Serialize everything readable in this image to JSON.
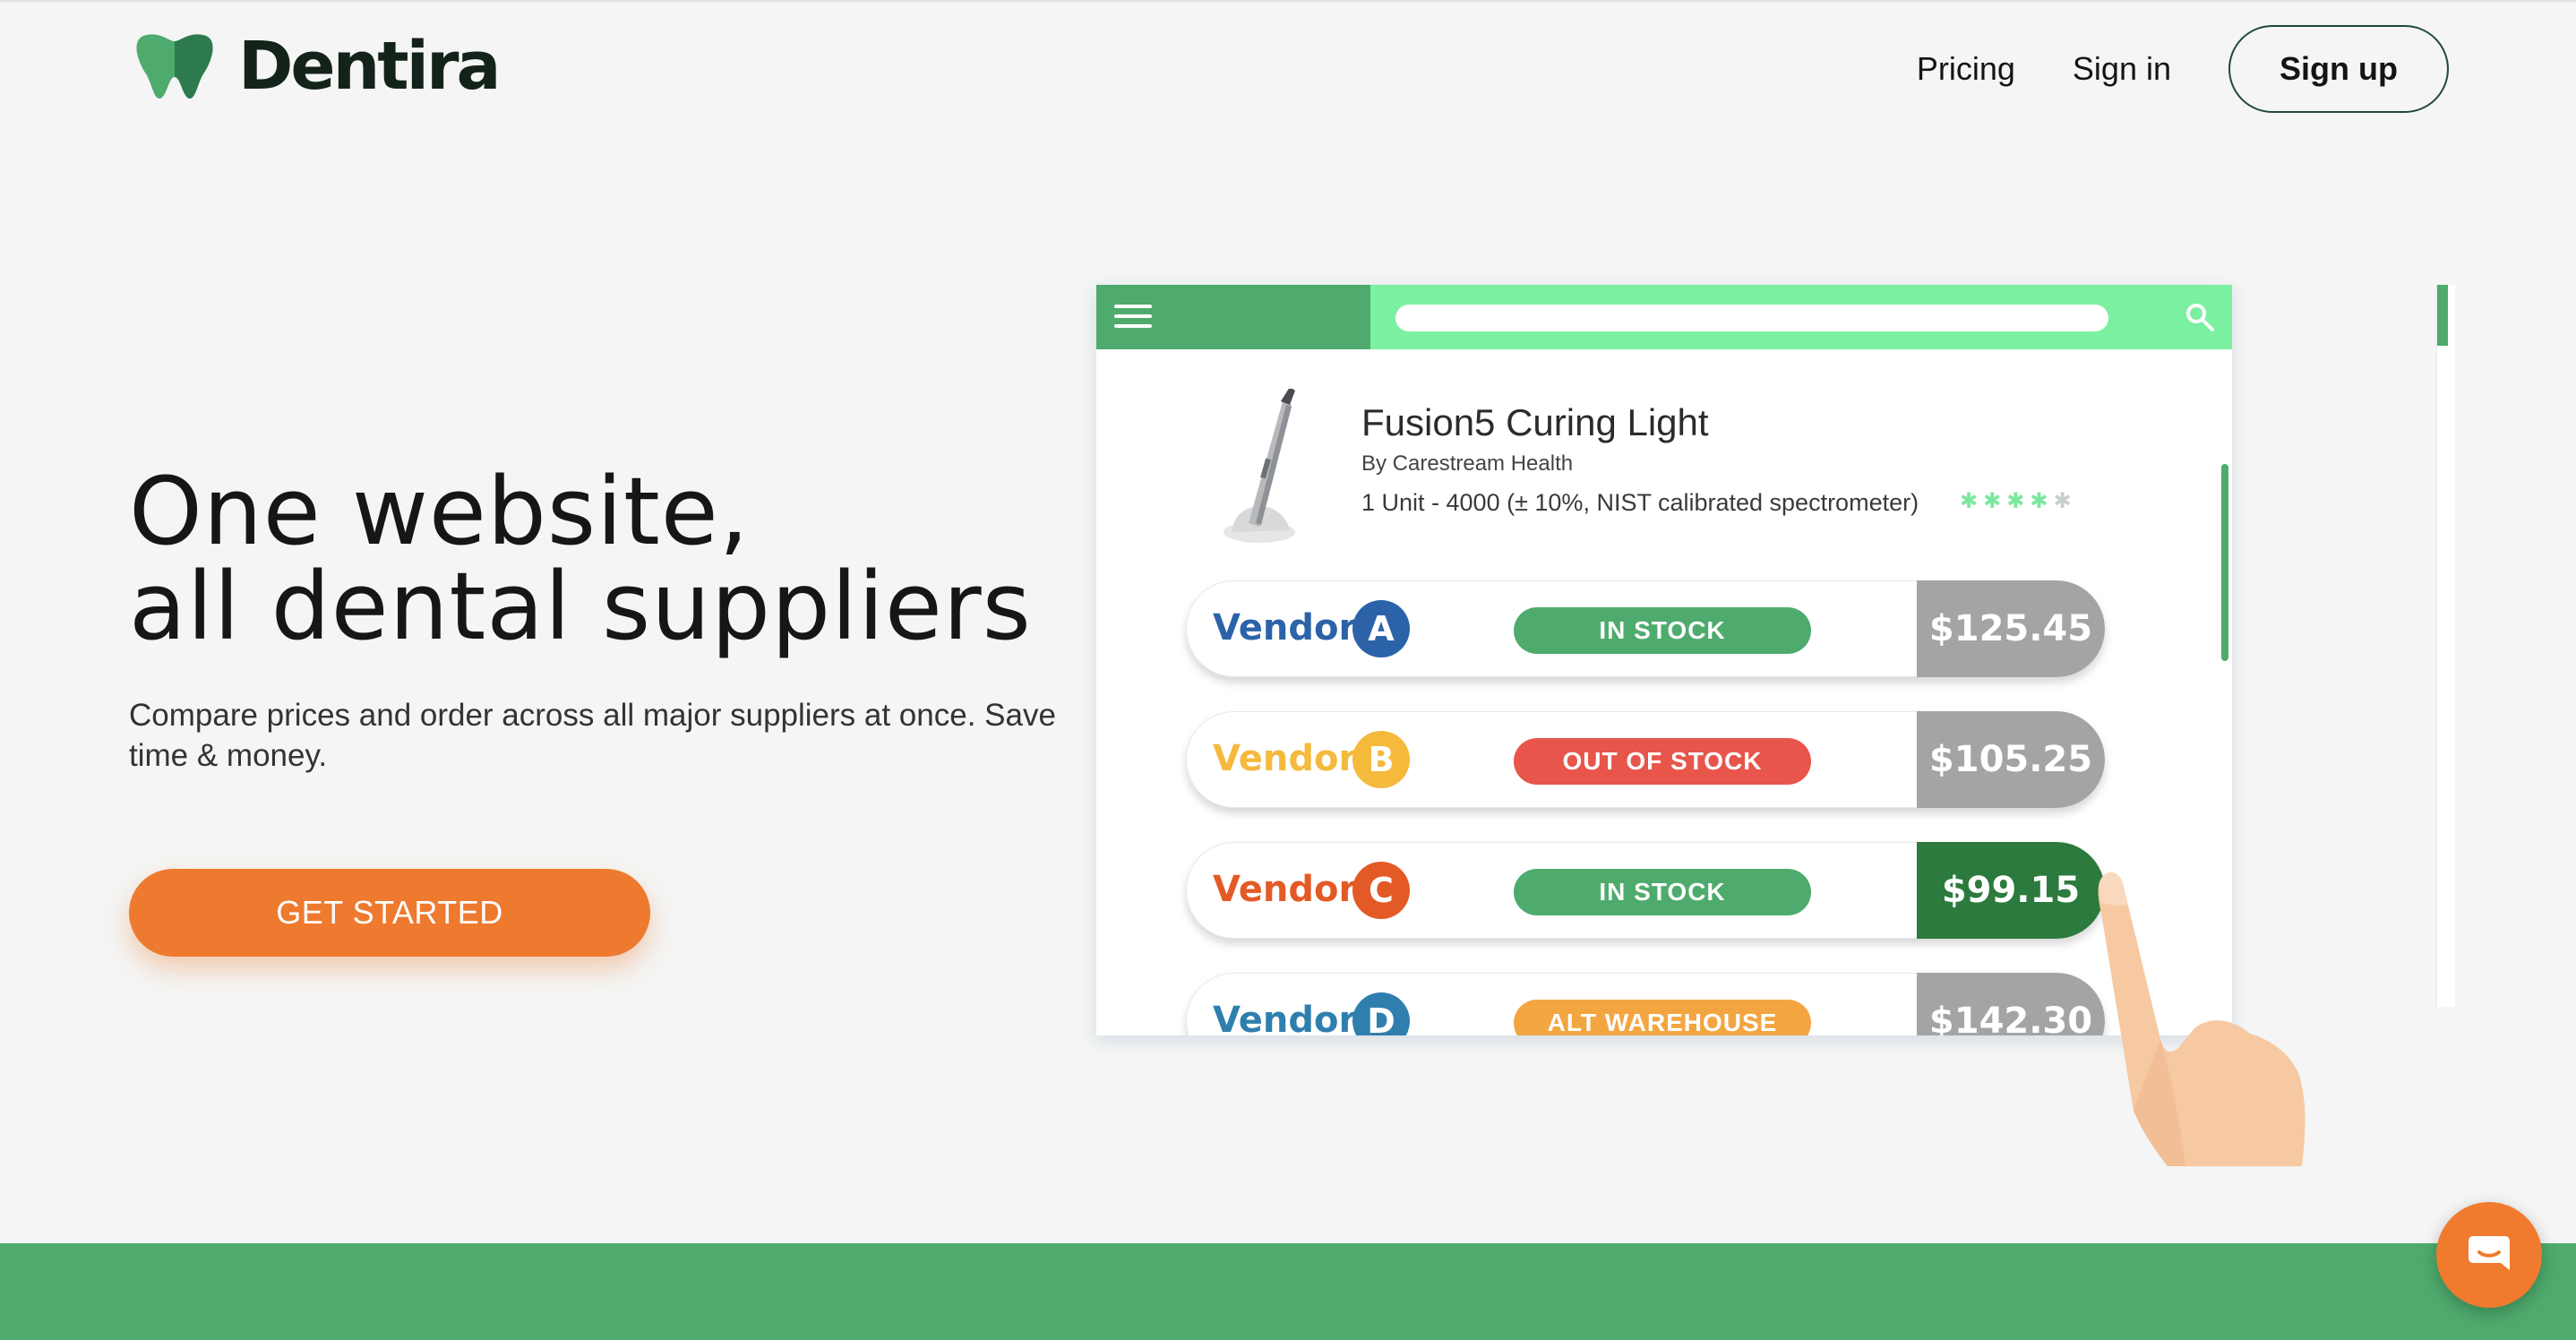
{
  "brand": {
    "name": "Dentira",
    "logo_icon": "tooth-icon"
  },
  "nav": {
    "pricing": "Pricing",
    "signin": "Sign in",
    "signup": "Sign up"
  },
  "hero": {
    "title_line1": "One website,",
    "title_line2": "all dental suppliers",
    "subtitle": "Compare prices and order across all major suppliers at once. Save time & money.",
    "cta": "GET STARTED"
  },
  "mockup": {
    "product": {
      "name": "Fusion5 Curing Light",
      "brand": "By Carestream Health",
      "spec": "1 Unit - 4000 (± 10%, NIST calibrated spectrometer)",
      "rating_stars_filled": 4,
      "rating_stars_total": 5
    },
    "vendors": [
      {
        "name": "Vendor",
        "letter": "A",
        "color": "#2c63a8",
        "stock": "IN STOCK",
        "stock_color": "#4eab6d",
        "price": "$125.45",
        "best": false
      },
      {
        "name": "Vendor",
        "letter": "B",
        "color": "#f5b93c",
        "stock": "OUT OF STOCK",
        "stock_color": "#e8554a",
        "price": "$105.25",
        "best": false
      },
      {
        "name": "Vendor",
        "letter": "C",
        "color": "#e45a26",
        "stock": "IN STOCK",
        "stock_color": "#4eab6d",
        "price": "$99.15",
        "best": true
      },
      {
        "name": "Vendor",
        "letter": "D",
        "color": "#2f7fae",
        "stock": "ALT WAREHOUSE",
        "stock_color": "#f3a541",
        "price": "$142.30",
        "best": false
      }
    ]
  },
  "colors": {
    "brand_green": "#4eab6d",
    "accent_orange": "#ee7a30",
    "best_price_green": "#2c7a3d"
  },
  "icons": {
    "menu": "hamburger-menu-icon",
    "search": "search-icon",
    "chat": "chat-icon",
    "pointer": "pointing-hand-illustration"
  }
}
